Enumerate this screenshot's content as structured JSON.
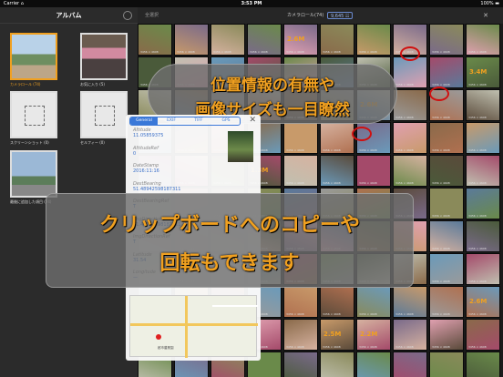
{
  "status": {
    "carrier": "Carrier ⌂",
    "time": "3:53 PM",
    "battery": "100% ▬"
  },
  "sidebar": {
    "title": "アルバム",
    "albums": [
      {
        "label": "カメラロール (74)",
        "selected": true
      },
      {
        "label": "お気に入り (5)"
      },
      {
        "label": "スクリーンショット (0)"
      },
      {
        "label": "セルフィー (0)"
      },
      {
        "label": "最後に追加した項目 (74)"
      }
    ]
  },
  "toolbar": {
    "select_all": "全選択",
    "roll": "カメラロール(74)",
    "count": "9,645 ☷",
    "close": "✕"
  },
  "grid": {
    "size_label": "3456 × 4608",
    "mb_labels": [
      "4.7M",
      "2.6M",
      "3.4M",
      "2.6M",
      "3.4M",
      "1.8M",
      "1.3M",
      "2.2M",
      "2.6M",
      "2.5M"
    ]
  },
  "panel": {
    "tabs": [
      "General",
      "EXIF",
      "TIFF",
      "GPS"
    ],
    "close": "✕",
    "fields": [
      {
        "key": "Altitude",
        "value": "11.05859375"
      },
      {
        "key": "AltitudeRef",
        "value": "0"
      },
      {
        "key": "DateStamp",
        "value": "2016:11:16"
      },
      {
        "key": "DestBearing",
        "value": "51.48942598187311"
      },
      {
        "key": "DestBearingRef",
        "value": "T"
      },
      {
        "key": "ImgDirection",
        "value": "51.48942598187311"
      },
      {
        "key": "ImgDirectionRef",
        "value": "T"
      },
      {
        "key": "Latitude",
        "value": "31.54"
      },
      {
        "key": "Longitude",
        "value": "—"
      }
    ],
    "map_place": "都市農業園"
  },
  "callout1": {
    "line1": "位置情報の有無や",
    "line2": "画像サイズも一目瞭然"
  },
  "callout2": {
    "line1": "クリップボードへのコピーや",
    "line2": "回転もできます"
  }
}
